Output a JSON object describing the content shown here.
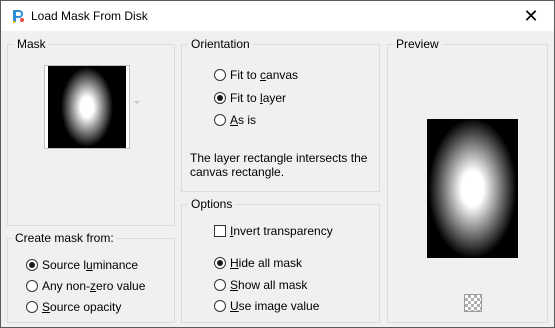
{
  "window": {
    "title": "Load Mask From Disk",
    "close_glyph": "✕"
  },
  "mask": {
    "label": "Mask"
  },
  "orientation": {
    "label": "Orientation",
    "options": [
      {
        "pre": "Fit to ",
        "u": "c",
        "post": "anvas",
        "selected": false
      },
      {
        "pre": "Fit to ",
        "u": "l",
        "post": "ayer",
        "selected": true
      },
      {
        "pre": "",
        "u": "A",
        "post": "s is",
        "selected": false
      }
    ],
    "description": "The layer rectangle intersects the canvas rectangle."
  },
  "options": {
    "label": "Options",
    "invert": {
      "pre": "",
      "u": "I",
      "post": "nvert transparency",
      "checked": false
    },
    "radios": [
      {
        "pre": "",
        "u": "H",
        "post": "ide all mask",
        "selected": true
      },
      {
        "pre": "",
        "u": "S",
        "post": "how all mask",
        "selected": false
      },
      {
        "pre": "",
        "u": "U",
        "post": "se image value",
        "selected": false
      }
    ]
  },
  "create_from": {
    "label": "Create mask from:",
    "radios": [
      {
        "pre": "Source l",
        "u": "u",
        "post": "minance",
        "selected": true
      },
      {
        "pre": "Any non-",
        "u": "z",
        "post": "ero value",
        "selected": false
      },
      {
        "pre": "",
        "u": "S",
        "post": "ource opacity",
        "selected": false
      }
    ]
  },
  "preview": {
    "label": "Preview"
  },
  "icons": {
    "app": "paint-app-icon",
    "close": "close-icon",
    "checker": "transparency-checker-icon"
  }
}
